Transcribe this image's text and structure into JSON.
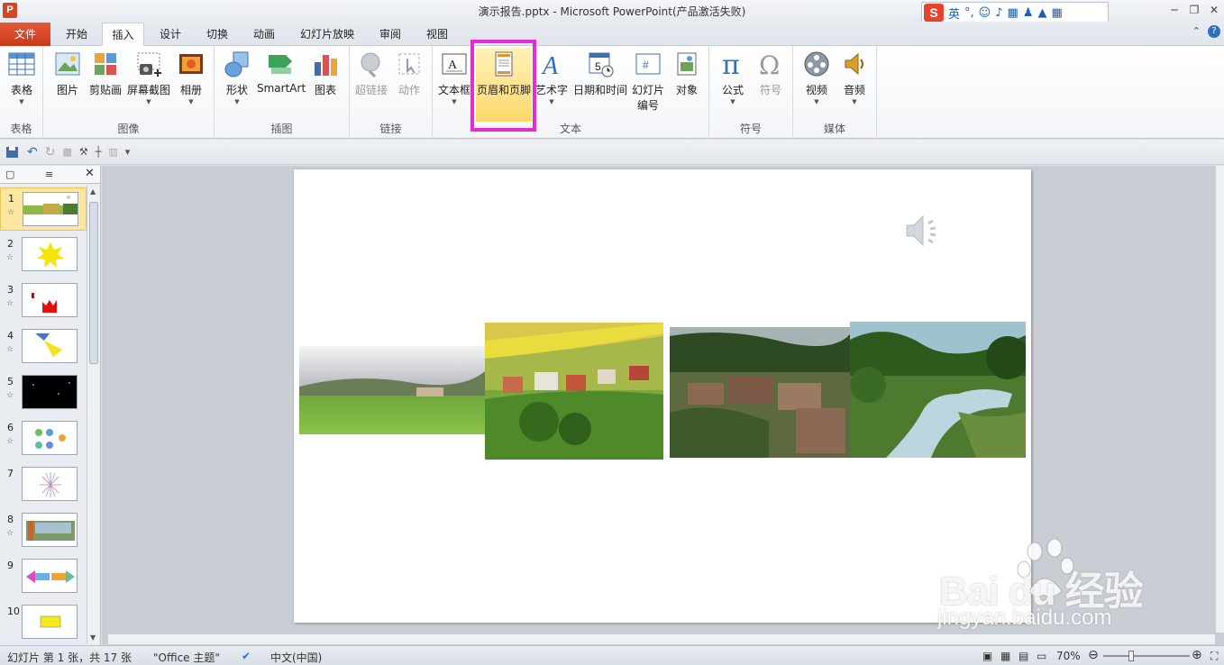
{
  "window": {
    "title": "演示报告.pptx - Microsoft PowerPoint(产品激活失败)",
    "app_icon": "P",
    "controls": [
      "─",
      "❐",
      "✕"
    ]
  },
  "ime": {
    "logo": "S",
    "mode": "英"
  },
  "tabs": [
    {
      "label": "文件",
      "active": false
    },
    {
      "label": "开始",
      "active": false
    },
    {
      "label": "插入",
      "active": true
    },
    {
      "label": "设计",
      "active": false
    },
    {
      "label": "切换",
      "active": false
    },
    {
      "label": "动画",
      "active": false
    },
    {
      "label": "幻灯片放映",
      "active": false
    },
    {
      "label": "审阅",
      "active": false
    },
    {
      "label": "视图",
      "active": false
    }
  ],
  "ribbon": {
    "groups": {
      "table": "表格",
      "images": "图像",
      "illustrations": "插图",
      "links": "链接",
      "text": "文本",
      "symbols": "符号",
      "media": "媒体"
    },
    "buttons": {
      "table": "表格",
      "picture": "图片",
      "clipart": "剪贴画",
      "screenshot": "屏幕截图",
      "album": "相册",
      "shapes": "形状",
      "smartart": "SmartArt",
      "chart": "图表",
      "hyperlink": "超链接",
      "action": "动作",
      "textbox": "文本框",
      "header_footer": "页眉和页脚",
      "wordart": "艺术字",
      "datetime": "日期和时间",
      "slide_number_1": "幻灯片",
      "slide_number_2": "编号",
      "object": "对象",
      "equation": "公式",
      "symbol": "符号",
      "video": "视频",
      "audio": "音频"
    },
    "highlight_color": "#e52bd4"
  },
  "slides_pane": {
    "tab_slides_icon": "slides-tab-icon",
    "tab_outline_icon": "outline-tab-icon",
    "close": "✕",
    "thumbnails": [
      {
        "num": "1",
        "star": "☆",
        "selected": true
      },
      {
        "num": "2",
        "star": "☆",
        "selected": false
      },
      {
        "num": "3",
        "star": "☆",
        "selected": false
      },
      {
        "num": "4",
        "star": "☆",
        "selected": false
      },
      {
        "num": "5",
        "star": "☆",
        "selected": false
      },
      {
        "num": "6",
        "star": "☆",
        "selected": false
      },
      {
        "num": "7",
        "star": "",
        "selected": false
      },
      {
        "num": "8",
        "star": "☆",
        "selected": false
      },
      {
        "num": "9",
        "star": "",
        "selected": false
      },
      {
        "num": "10",
        "star": "",
        "selected": false
      }
    ]
  },
  "status": {
    "slide_info": "幻灯片 第 1 张，共 17 张",
    "theme": "\"Office 主题\"",
    "language": "中文(中国)",
    "zoom": "70%"
  },
  "watermark": {
    "brand": "Bai du 经验",
    "url": "jingyan.baidu.com"
  }
}
